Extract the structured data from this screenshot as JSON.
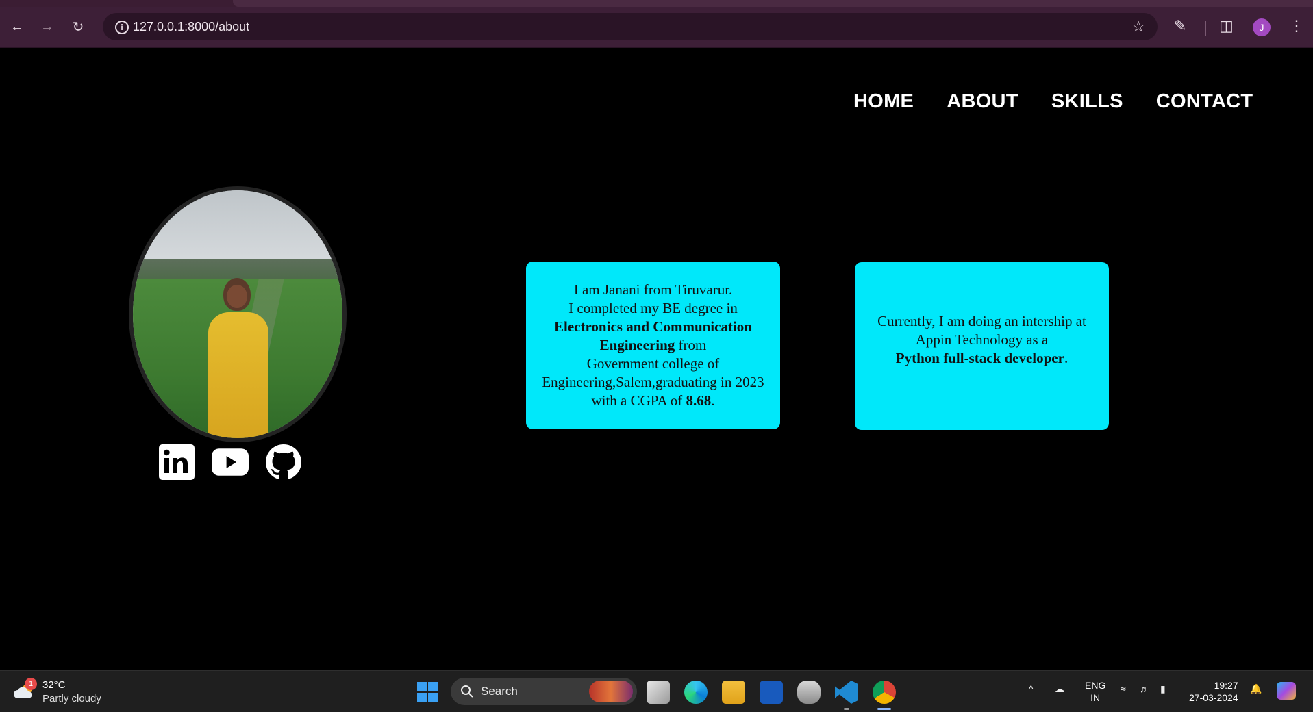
{
  "browser": {
    "url": "127.0.0.1:8000/about",
    "profile_initial": "J"
  },
  "nav": {
    "items": [
      "HOME",
      "ABOUT",
      "SKILLS",
      "CONTACT"
    ]
  },
  "profile": {
    "socials": [
      "linkedin-icon",
      "youtube-icon",
      "github-icon"
    ]
  },
  "cards": {
    "intro": {
      "line1": "I am Janani from Tiruvarur.",
      "line2": "I completed my BE degree in",
      "degree": "Electronics and Communication Engineering",
      "from": " from",
      "college": "Government college of Engineering,Salem,graduating in 2023",
      "cgpa_prefix": "with a CGPA of ",
      "cgpa": "8.68",
      "cgpa_suffix": "."
    },
    "current": {
      "line1": "Currently, I am doing an intership at Appin Technology as a",
      "role": "Python full-stack developer",
      "suffix": "."
    }
  },
  "taskbar": {
    "weather": {
      "temp": "32°C",
      "condition": "Partly cloudy",
      "badge": "1"
    },
    "search_label": "Search",
    "lang_top": "ENG",
    "lang_bottom": "IN",
    "time": "19:27",
    "date": "27-03-2024"
  },
  "colors": {
    "card_bg": "#00e8fa",
    "page_bg": "#000000",
    "chrome_bg": "#3d1f37"
  }
}
